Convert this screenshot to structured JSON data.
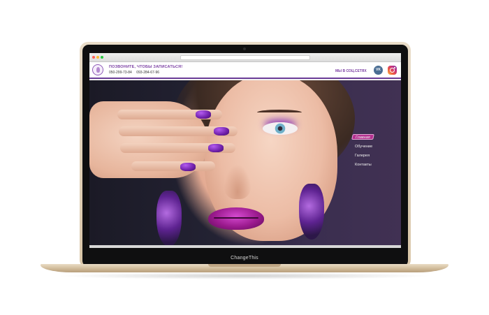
{
  "device": {
    "brand_label": "ChangeThis"
  },
  "browser": {
    "tab_left": "",
    "tab_mid": "",
    "tab_right": "",
    "address": ""
  },
  "header": {
    "call_title": "ПОЗВОНИТЕ, ЧТОБЫ ЗАПИСАТЬСЯ!",
    "phones": [
      "050-299-73-84",
      "093-284-67-96"
    ],
    "social_title": "МЫ В СОЦ.СЕТЯХ",
    "vk_icon_label": "VK",
    "accent_color": "#6a3c97"
  },
  "nav": {
    "items": [
      {
        "label": "Главная",
        "active": true
      },
      {
        "label": "Обучение",
        "active": false
      },
      {
        "label": "Галерея",
        "active": false
      },
      {
        "label": "Контакты",
        "active": false
      }
    ]
  },
  "icons": {
    "logo": "logo-icon",
    "vk": "vk-icon",
    "instagram": "instagram-icon"
  }
}
